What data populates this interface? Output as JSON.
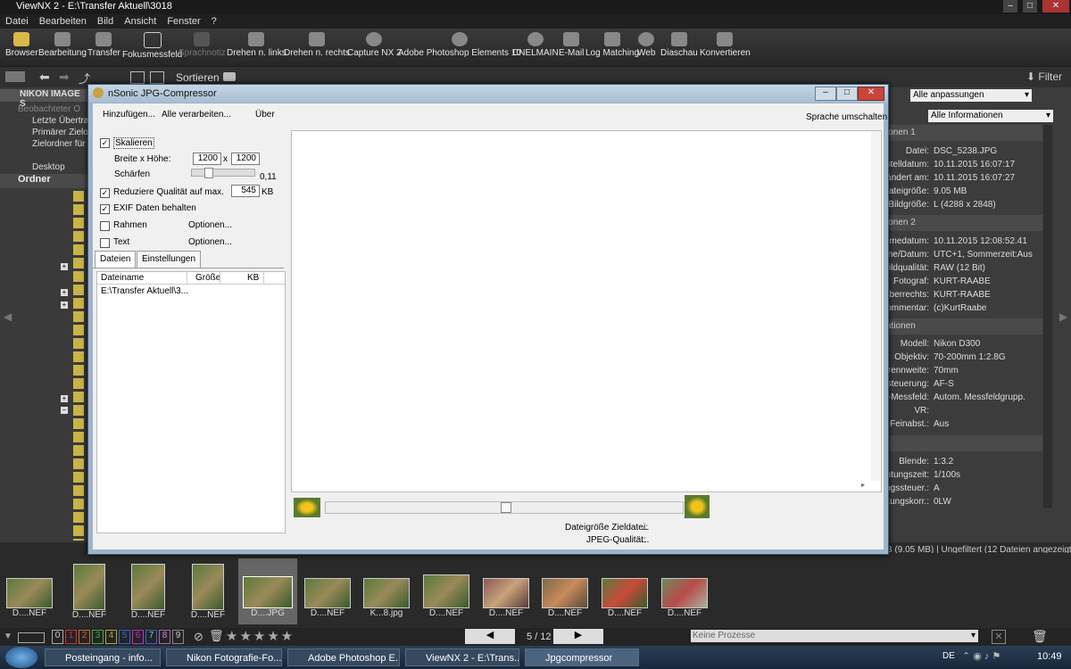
{
  "window": {
    "title": "ViewNX 2 - E:\\Transfer Aktuell\\3018"
  },
  "menu": [
    "Datei",
    "Bearbeiten",
    "Bild",
    "Ansicht",
    "Fenster",
    "?"
  ],
  "toolbar": [
    {
      "label": "Browser",
      "icon": "browser-icon"
    },
    {
      "label": "Bearbeitung",
      "icon": "edit-icon"
    },
    {
      "label": "Transfer",
      "icon": "camera-icon"
    },
    {
      "label": "Fokusmessfeld",
      "icon": "focus-icon"
    },
    {
      "label": "Sprachnotiz",
      "icon": "voice-memo-icon"
    },
    {
      "label": "Drehen n. links",
      "icon": "rotate-left-icon"
    },
    {
      "label": "Drehen n. rechts",
      "icon": "rotate-right-icon"
    },
    {
      "label": "Capture NX 2",
      "icon": "capture-nx-icon"
    },
    {
      "label": "Adobe Photoshop Elements 10",
      "icon": "app-icon"
    },
    {
      "label": "CNELMAIN",
      "icon": "app-icon"
    },
    {
      "label": "E-Mail",
      "icon": "mail-icon"
    },
    {
      "label": "Log Matching",
      "icon": "log-matching-icon"
    },
    {
      "label": "Web",
      "icon": "web-icon"
    },
    {
      "label": "Diaschau",
      "icon": "slideshow-icon"
    },
    {
      "label": "Konvertieren",
      "icon": "convert-icon"
    }
  ],
  "toolbar2": {
    "sort_label": "Sortieren",
    "filter_label": "Filter"
  },
  "left_panel": {
    "header": "NIKON IMAGE S",
    "items": [
      "Beobachteter O",
      "Letzte Übertrag",
      "Primärer Zielord",
      "Zielordner für S"
    ],
    "desktop": "Desktop",
    "folders_header": "Ordner"
  },
  "right_panel": {
    "dropdown1": "Alle anpassungen",
    "dropdown2": "Alle Informationen",
    "section1": "ionen 1",
    "rows1": [
      {
        "k": "Datei:",
        "v": "DSC_5238.JPG"
      },
      {
        "k": "rstelldatum:",
        "v": "10.11.2015 16:07:17"
      },
      {
        "k": "geändert am:",
        "v": "10.11.2015 16:07:27"
      },
      {
        "k": "Dateigröße:",
        "v": "9.05 MB"
      },
      {
        "k": "Bildgröße:",
        "v": "L (4288 x 2848)"
      }
    ],
    "section2": "ionen 2",
    "rows2": [
      {
        "k": "hmedatum:",
        "v": "10.11.2015 12:08:52.41"
      },
      {
        "k": "one/Datum:",
        "v": "UTC+1, Sommerzeit:Aus"
      },
      {
        "k": "Bildqualität:",
        "v": "RAW (12 Bit)"
      },
      {
        "k": "Fotograf:",
        "v": "KURT-RAABE"
      },
      {
        "k": "eberrechts:",
        "v": "KURT-RAABE"
      },
      {
        "k": "kommentar:",
        "v": "(c)KurtRaabe"
      }
    ],
    "section3": "ationen",
    "rows3": [
      {
        "k": "Modell:",
        "v": "Nikon D300"
      },
      {
        "k": "Objektiv:",
        "v": "70-200mm 1:2.8G"
      },
      {
        "k": "Brennweite:",
        "v": "70mm"
      },
      {
        "k": "steuerung:",
        "v": "AF-S"
      },
      {
        "k": "F-Messfeld:",
        "v": "Autom. Messfeldgrupp."
      },
      {
        "k": "VR:",
        "v": ""
      },
      {
        "k": "F-Feinabst.:",
        "v": "Aus"
      }
    ],
    "rows4": [
      {
        "k": "Blende:",
        "v": "1:3.2"
      },
      {
        "k": "chtungszeit:",
        "v": "1/100s"
      },
      {
        "k": "ngssteuer.:",
        "v": "A"
      },
      {
        "k": "tungskorr.:",
        "v": "0LW"
      }
    ],
    "status": "B (9.05 MB) | Ungefiltert (12 Dateien angezeigt)"
  },
  "dialog": {
    "title": "nSonic JPG-Compressor",
    "menu": [
      "Hinzufügen...",
      "Alle verarbeiten...",
      "Über"
    ],
    "language_link": "Sprache umschalten",
    "scale_label": "Skalieren",
    "wh_label": "Breite x Höhe:",
    "width": "1200",
    "x_sep": "x",
    "height": "1200",
    "sharpen_label": "Schärfen",
    "sharpen_value": "0,11",
    "reduce_label": "Reduziere Qualität auf max.",
    "reduce_value": "545",
    "reduce_unit": "KB",
    "exif_label": "EXIF Daten behalten",
    "frame_label": "Rahmen",
    "text_label": "Text",
    "options_label": "Optionen...",
    "tabs": [
      "Dateien",
      "Einstellungen"
    ],
    "columns": [
      "Dateiname",
      "Größe",
      "KB"
    ],
    "file_row": "E:\\Transfer Aktuell\\3...",
    "target_size_label": "Dateigröße Zieldatei:",
    "target_size_value": "...",
    "jpeg_quality_label": "JPEG-Qualität:",
    "jpeg_quality_value": "..."
  },
  "filmstrip": [
    {
      "label": "D....NEF"
    },
    {
      "label": "D....NEF"
    },
    {
      "label": "D....NEF"
    },
    {
      "label": "D....NEF"
    },
    {
      "label": "D....JPG"
    },
    {
      "label": "D....NEF"
    },
    {
      "label": "K...8.jpg"
    },
    {
      "label": "D....NEF"
    },
    {
      "label": "D....NEF"
    },
    {
      "label": "D....NEF"
    },
    {
      "label": "D....NEF"
    },
    {
      "label": "D....NEF"
    }
  ],
  "bottom_bar": {
    "ratings": [
      "0",
      "1",
      "2",
      "3",
      "4",
      "5",
      "6",
      "7",
      "8",
      "9"
    ],
    "page_indicator": "5 / 12",
    "process_status": "Keine Prozesse"
  },
  "taskbar": {
    "tasks": [
      "Posteingang - info...",
      "Nikon Fotografie-Fo...",
      "Adobe Photoshop E...",
      "ViewNX 2 - E:\\Trans...",
      "Jpgcompressor"
    ],
    "lang": "DE",
    "clock": "10:49"
  }
}
